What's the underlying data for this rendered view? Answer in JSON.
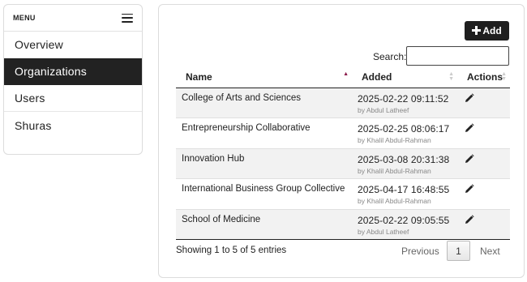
{
  "sidebar": {
    "title": "MENU",
    "items": [
      {
        "label": "Overview",
        "active": false
      },
      {
        "label": "Organizations",
        "active": true
      },
      {
        "label": "Users",
        "active": false
      },
      {
        "label": "Shuras",
        "active": false
      }
    ]
  },
  "toolbar": {
    "add_label": "Add",
    "search_label": "Search:",
    "search_value": ""
  },
  "table": {
    "columns": [
      "Name",
      "Added",
      "Actions"
    ],
    "sorted_column": "Name",
    "sort_direction": "asc",
    "rows": [
      {
        "name": "College of Arts and Sciences",
        "date": "2025-02-22 09:11:52",
        "by": "by Abdul Latheef"
      },
      {
        "name": "Entrepreneurship Collaborative",
        "date": "2025-02-25 08:06:17",
        "by": "by Khalil Abdul-Rahman"
      },
      {
        "name": "Innovation Hub",
        "date": "2025-03-08 20:31:38",
        "by": "by Khalil Abdul-Rahman"
      },
      {
        "name": "International Business Group Collective",
        "date": "2025-04-17 16:48:55",
        "by": "by Khalil Abdul-Rahman"
      },
      {
        "name": "School of Medicine",
        "date": "2025-02-22 09:05:55",
        "by": "by Abdul Latheef"
      }
    ]
  },
  "footer": {
    "info": "Showing 1 to 5 of 5 entries",
    "previous": "Previous",
    "current_page": "1",
    "next": "Next"
  },
  "icons": {
    "hamburger": "hamburger-menu-icon",
    "add": "plus-icon",
    "edit": "pencil-icon"
  },
  "colors": {
    "active_nav_bg": "#222222",
    "sort_active": "#8b1a4a",
    "stripe": "#f2f2f2"
  }
}
